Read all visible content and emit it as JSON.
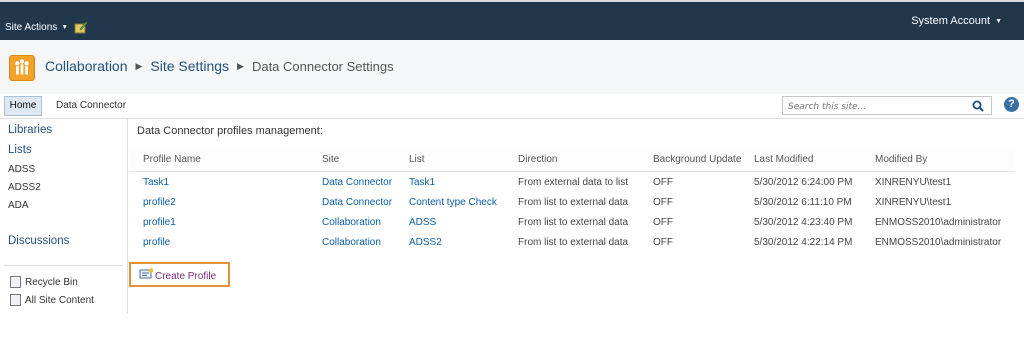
{
  "topbar": {
    "site_actions": "Site Actions",
    "user": "System Account"
  },
  "titlebar": {
    "breadcrumb": [
      "Collaboration",
      "Site Settings",
      "Data Connector Settings"
    ]
  },
  "nav": {
    "home": "Home",
    "data_connector": "Data Connector",
    "search_placeholder": "Search this site..."
  },
  "leftnav": {
    "libraries": "Libraries",
    "lists": "Lists",
    "list_items": [
      "ADSS",
      "ADSS2",
      "ADA"
    ],
    "discussions": "Discussions",
    "recycle_bin": "Recycle Bin",
    "all_site_content": "All Site Content"
  },
  "main": {
    "heading": "Data Connector profiles management:",
    "columns": [
      "Profile Name",
      "Site",
      "List",
      "Direction",
      "Background Update",
      "Last Modified",
      "Modified By"
    ],
    "rows": [
      [
        "Task1",
        "Data Connector",
        "Task1",
        "From external data to list",
        "OFF",
        "5/30/2012 6:24:00 PM",
        "XINRENYU\\test1"
      ],
      [
        "profile2",
        "Data Connector",
        "Content type Check",
        "From list to external data",
        "OFF",
        "5/30/2012 6:11:10 PM",
        "XINRENYU\\test1"
      ],
      [
        "profile1",
        "Collaboration",
        "ADSS",
        "From list to external data",
        "OFF",
        "5/30/2012 4:23:40 PM",
        "ENMOSS2010\\administrator"
      ],
      [
        "profile",
        "Collaboration",
        "ADSS2",
        "From list to external data",
        "OFF",
        "5/30/2012 4:22:14 PM",
        "ENMOSS2010\\administrator"
      ]
    ],
    "create_profile": "Create Profile"
  },
  "colors": {
    "topbar": "#21374c",
    "link": "#0b5fa5",
    "highlight_border": "#e6913a"
  }
}
